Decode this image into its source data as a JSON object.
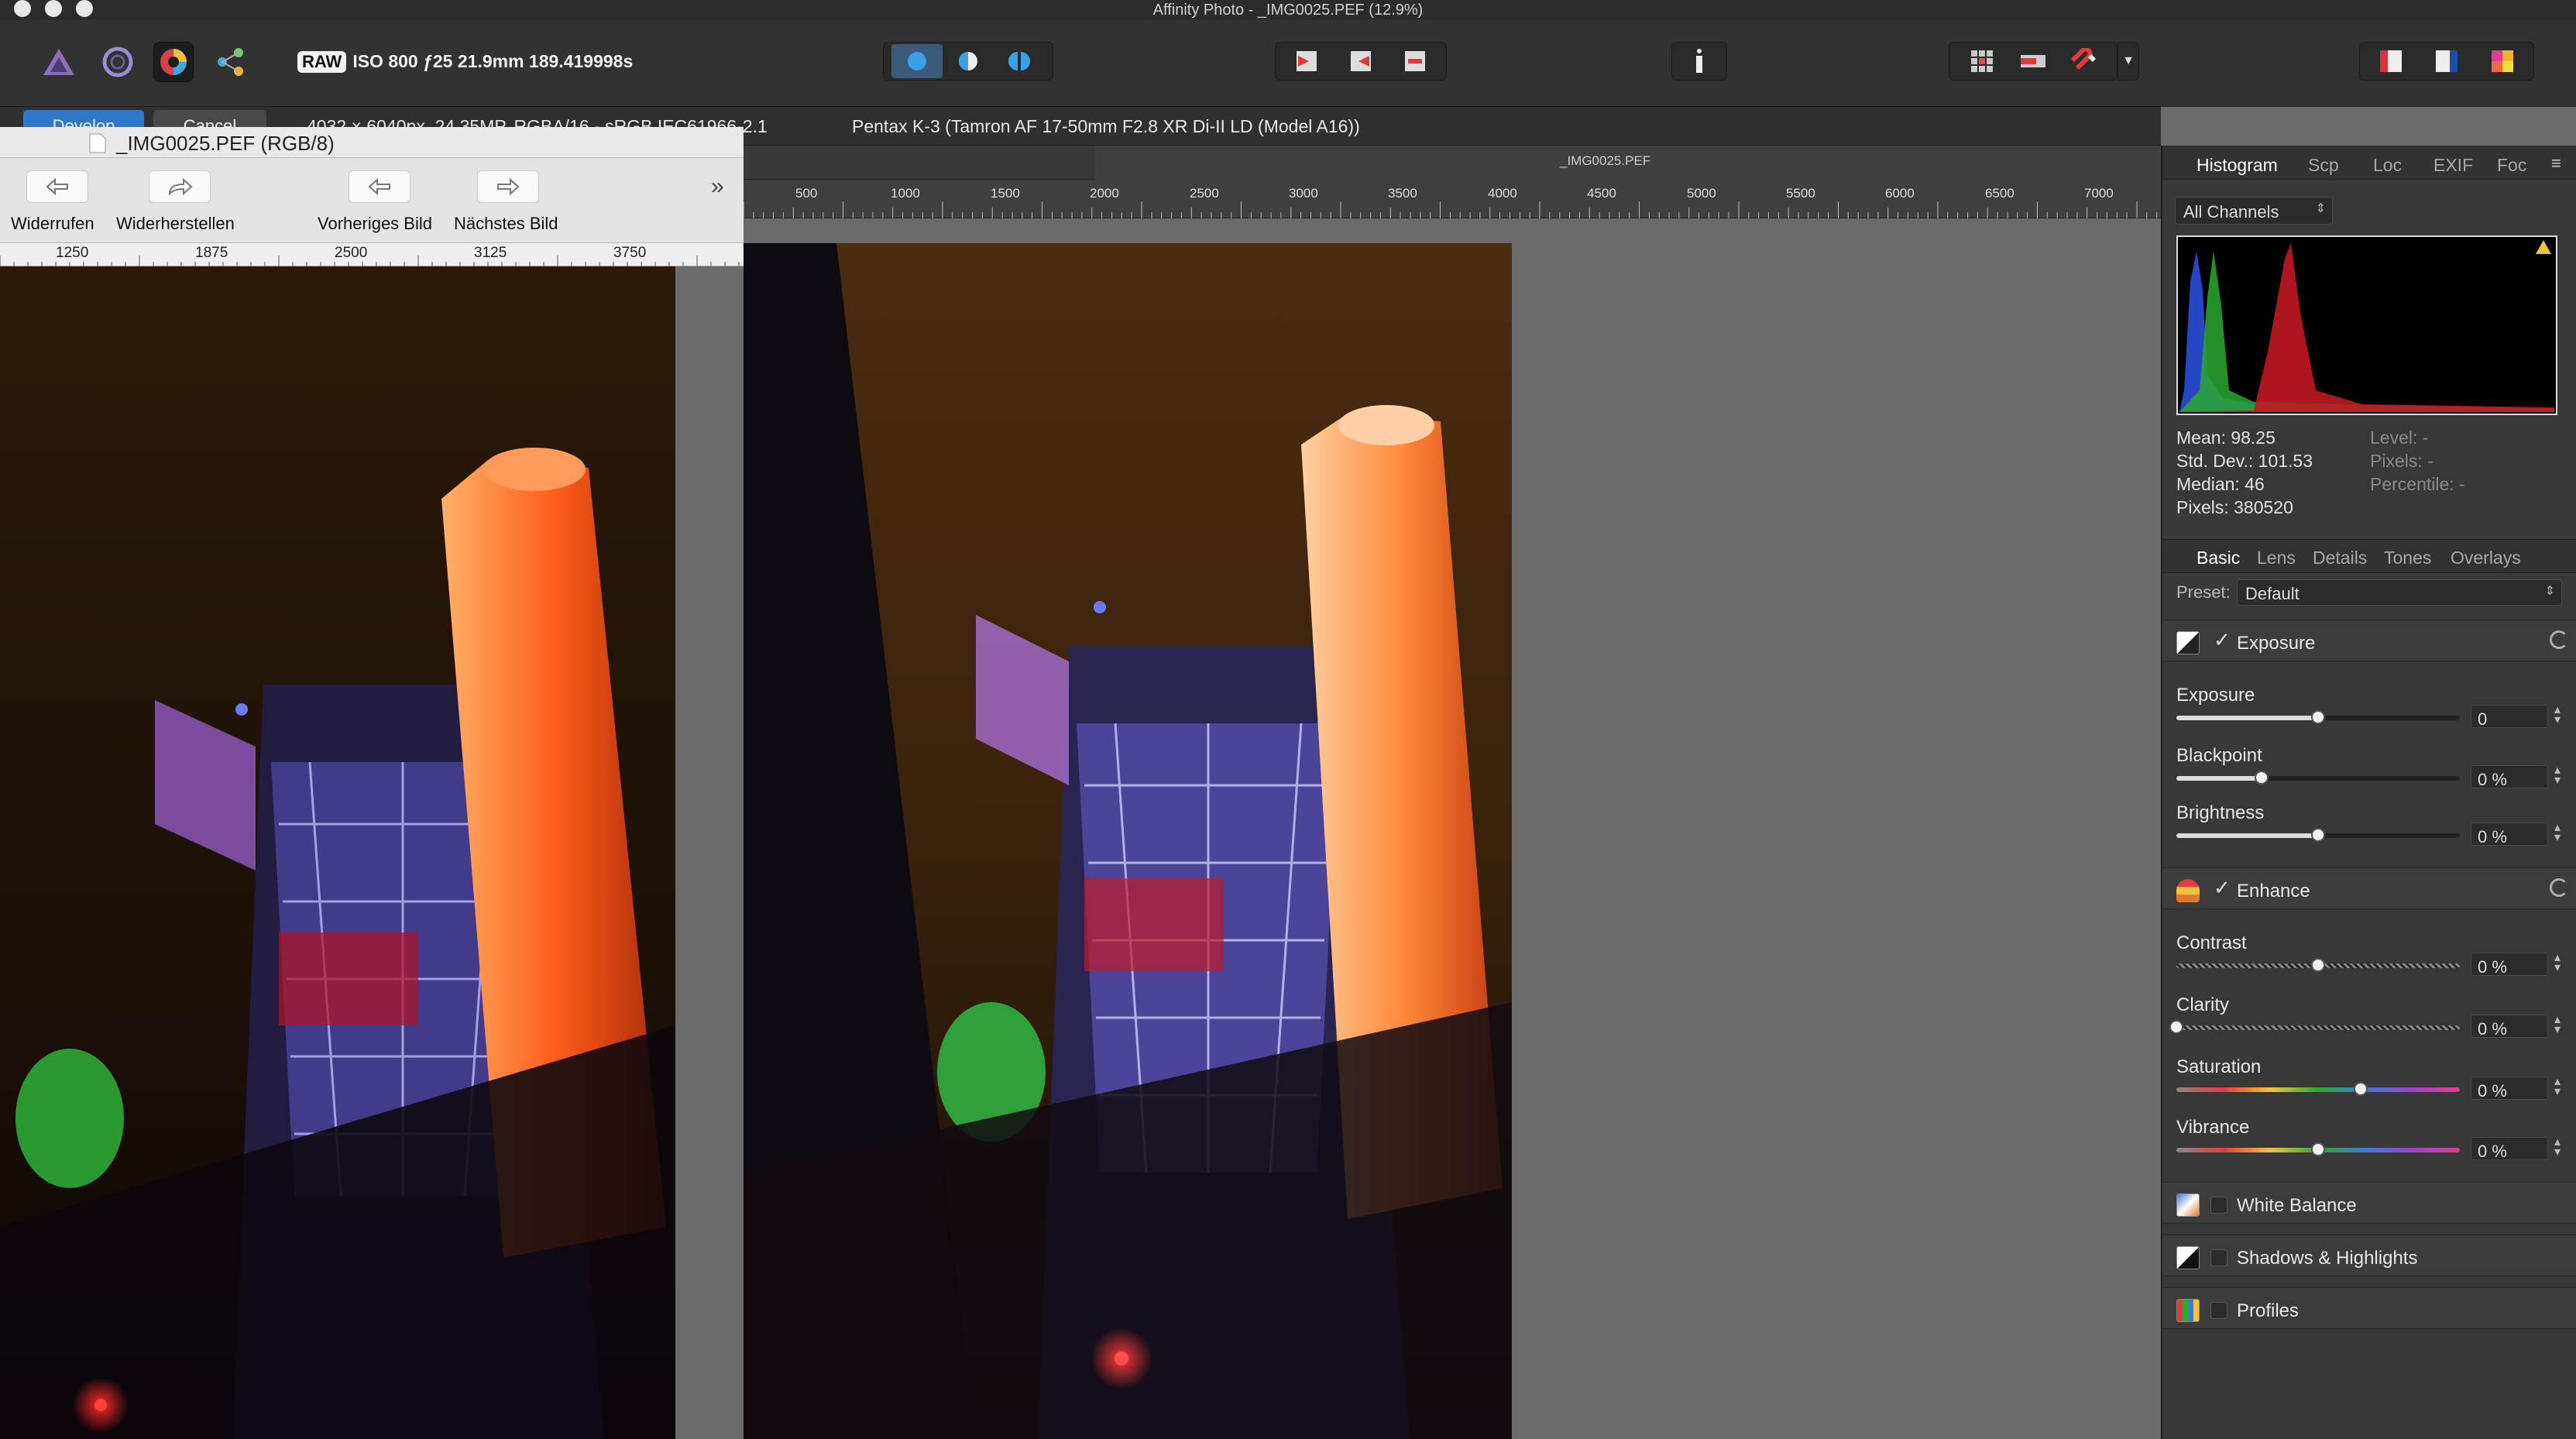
{
  "app": {
    "title": "Affinity Photo - _IMG0025.PEF (12.9%)"
  },
  "toolbar": {
    "raw_badge": "RAW",
    "exif_summary": "ISO 800 ƒ25 21.9mm 189.419998s",
    "personas": [
      "photo-persona-icon",
      "liquify-persona-icon",
      "develop-persona-icon",
      "export-persona-icon"
    ]
  },
  "context": {
    "develop_label": "Develop",
    "cancel_label": "Cancel",
    "image_info": "4032 × 6040px, 24.35MP, RGBA/16 - sRGB IEC61966-2.1",
    "lens_info": "Pentax K-3 (Tamron AF 17-50mm F2.8 XR Di-II LD (Model A16))"
  },
  "document": {
    "tab_name": "_IMG0025.PEF",
    "ruler_ticks": [
      "500",
      "1000",
      "1500",
      "2000",
      "2500",
      "3000",
      "3500",
      "4000",
      "4500",
      "5000",
      "5500",
      "6000",
      "6500",
      "7000"
    ]
  },
  "overlay": {
    "title": "_IMG0025.PEF (RGB/8)",
    "buttons": {
      "undo": "Widerrufen",
      "redo": "Widerherstellen",
      "prev": "Vorheriges Bild",
      "next": "Nächstes Bild"
    },
    "more": "»",
    "ruler_ticks": [
      "1250",
      "1875",
      "2500",
      "3125",
      "3750"
    ]
  },
  "panel": {
    "tabs_top": [
      "Histogram",
      "Scp",
      "Loc",
      "EXIF",
      "Foc"
    ],
    "channel_select": "All Channels",
    "stats_left": [
      "Mean: 98.25",
      "Std. Dev.: 101.53",
      "Median: 46",
      "Pixels: 380520"
    ],
    "stats_right": [
      "Level: -",
      "Pixels: -",
      "Percentile: -"
    ],
    "tabs_adjust": [
      "Basic",
      "Lens",
      "Details",
      "Tones",
      "Overlays"
    ],
    "preset_label": "Preset:",
    "preset_value": "Default",
    "exposure_section": "Exposure",
    "enhance_section": "Enhance",
    "sliders": [
      {
        "label": "Exposure",
        "value": "0",
        "level": 0.5
      },
      {
        "label": "Blackpoint",
        "value": "0 %",
        "level": 0.3
      },
      {
        "label": "Brightness",
        "value": "0 %",
        "level": 0.5
      },
      {
        "label": "Contrast",
        "value": "0 %",
        "level": 0.5
      },
      {
        "label": "Clarity",
        "value": "0 %",
        "level": 0.0
      },
      {
        "label": "Saturation",
        "value": "0 %",
        "level": 0.65
      },
      {
        "label": "Vibrance",
        "value": "0 %",
        "level": 0.5
      }
    ],
    "collapsed_sections": [
      "White Balance",
      "Shadows & Highlights",
      "Profiles"
    ],
    "checkmark": "✓"
  }
}
